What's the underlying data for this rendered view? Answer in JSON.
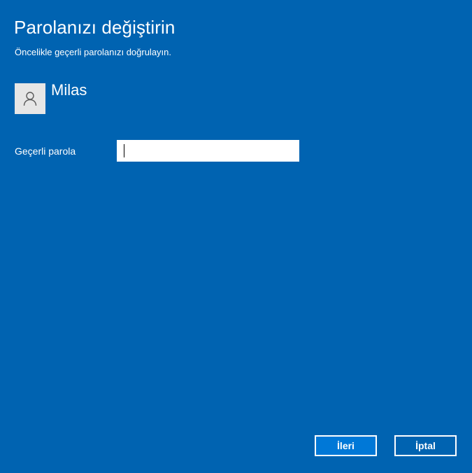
{
  "dialog": {
    "title": "Parolanızı değiştirin",
    "subtitle": "Öncelikle geçerli parolanızı doğrulayın."
  },
  "user": {
    "name": "Milas",
    "avatar_icon": "user-icon"
  },
  "form": {
    "current_password_label": "Geçerli parola",
    "current_password_value": ""
  },
  "buttons": {
    "next_label": "İleri",
    "cancel_label": "İptal"
  },
  "colors": {
    "background": "#0063B1",
    "primary_button": "#0078D7",
    "text": "#FFFFFF"
  }
}
